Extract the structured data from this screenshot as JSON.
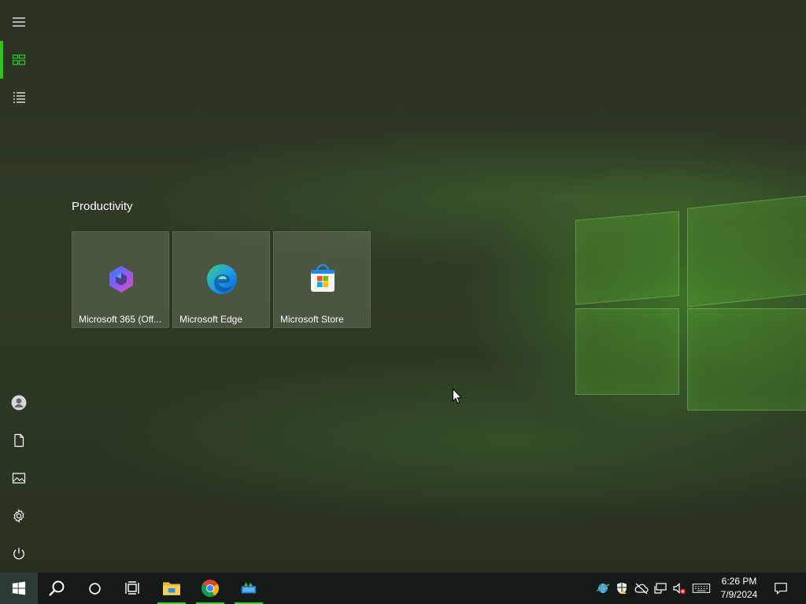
{
  "start_menu": {
    "group_title": "Productivity",
    "tiles": [
      {
        "label": "Microsoft 365 (Off...",
        "icon": "microsoft-365-icon"
      },
      {
        "label": "Microsoft Edge",
        "icon": "edge-icon"
      },
      {
        "label": "Microsoft Store",
        "icon": "store-icon"
      }
    ],
    "rail": [
      {
        "name": "expand-menu",
        "icon": "hamburger-icon"
      },
      {
        "name": "pinned-tiles",
        "icon": "tiles-icon",
        "active": true
      },
      {
        "name": "all-apps",
        "icon": "list-icon"
      },
      {
        "name": "account",
        "icon": "user-icon"
      },
      {
        "name": "documents",
        "icon": "document-icon"
      },
      {
        "name": "pictures",
        "icon": "picture-icon"
      },
      {
        "name": "settings",
        "icon": "gear-icon"
      },
      {
        "name": "power",
        "icon": "power-icon"
      }
    ]
  },
  "taskbar": {
    "buttons": [
      {
        "name": "start",
        "icon": "windows-icon"
      },
      {
        "name": "search",
        "icon": "search-icon"
      },
      {
        "name": "cortana",
        "icon": "circle-icon"
      },
      {
        "name": "task-view",
        "icon": "task-view-icon"
      },
      {
        "name": "file-explorer",
        "icon": "folder-icon",
        "running": true
      },
      {
        "name": "chrome",
        "icon": "chrome-icon",
        "running": true
      },
      {
        "name": "app",
        "icon": "app-icon",
        "running": true
      }
    ],
    "tray": [
      "network-globe-icon",
      "security-shield-icon",
      "onedrive-offline-icon",
      "network-icon",
      "volume-muted-icon",
      "keyboard-icon"
    ],
    "clock": {
      "time": "6:26 PM",
      "date": "7/9/2024"
    },
    "notifications_icon": "notification-icon"
  },
  "colors": {
    "accent": "#30c020",
    "taskbar": "#131a17"
  }
}
